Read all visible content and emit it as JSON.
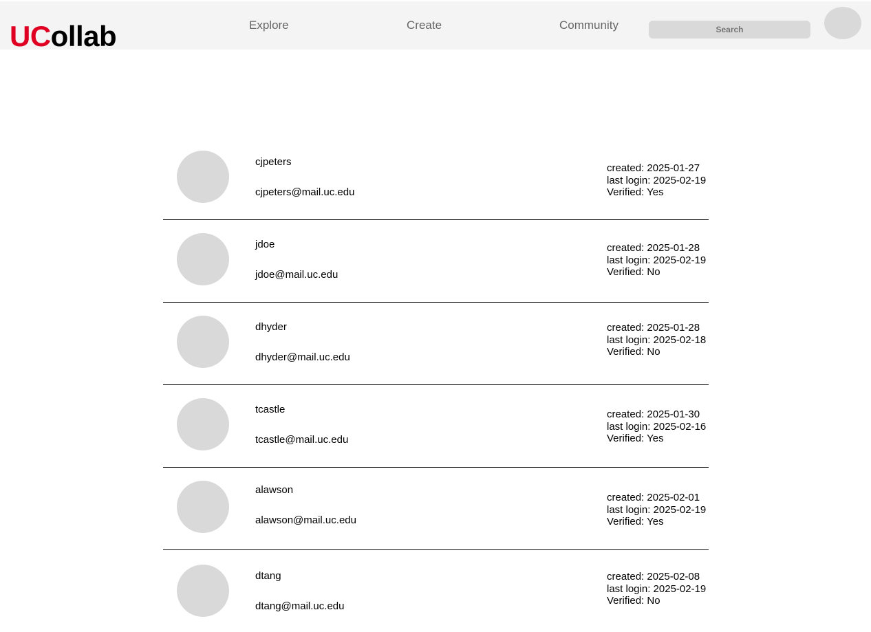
{
  "header": {
    "logo_accent": "UC",
    "logo_rest": "ollab",
    "nav": [
      {
        "label": "Explore"
      },
      {
        "label": "Create"
      },
      {
        "label": "Community"
      }
    ],
    "search_placeholder": "Search"
  },
  "colors": {
    "brand_red": "#e00122",
    "header_bg": "#f4f4f4",
    "placeholder_gray": "#d9d9d9"
  },
  "users": [
    {
      "username": "cjpeters",
      "email": "cjpeters@mail.uc.edu",
      "created": "created: 2025-01-27",
      "last_login": "last login: 2025-02-19",
      "verified": "Verified: Yes"
    },
    {
      "username": "jdoe",
      "email": "jdoe@mail.uc.edu",
      "created": "created: 2025-01-28",
      "last_login": "last login: 2025-02-19",
      "verified": "Verified: No"
    },
    {
      "username": "dhyder",
      "email": "dhyder@mail.uc.edu",
      "created": "created: 2025-01-28",
      "last_login": "last login: 2025-02-18",
      "verified": "Verified: No"
    },
    {
      "username": "tcastle",
      "email": "tcastle@mail.uc.edu",
      "created": "created: 2025-01-30",
      "last_login": "last login: 2025-02-16",
      "verified": "Verified: Yes"
    },
    {
      "username": "alawson",
      "email": "alawson@mail.uc.edu",
      "created": "created: 2025-02-01",
      "last_login": "last login: 2025-02-19",
      "verified": "Verified: Yes"
    },
    {
      "username": "dtang",
      "email": "dtang@mail.uc.edu",
      "created": "created: 2025-02-08",
      "last_login": "last login: 2025-02-19",
      "verified": "Verified: No"
    }
  ]
}
